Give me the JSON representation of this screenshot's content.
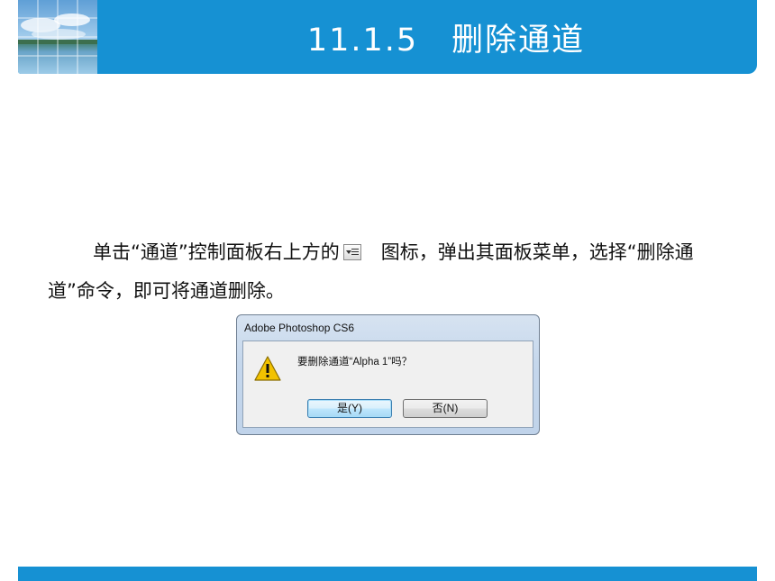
{
  "slide": {
    "title": "11.1.5　删除通道",
    "paragraph_before_icon": "单击“通道”控制面板右上方的",
    "paragraph_after_icon": "图标，弹出其面板菜单，选择“删除通道”命令，即可将通道删除。",
    "inline_icon": "panel-menu-icon"
  },
  "dialog": {
    "title": "Adobe Photoshop CS6",
    "message": "要删除通道“Alpha 1”吗？",
    "icon": "warning-icon",
    "yes_label": "是(Y)",
    "no_label": "否(N)"
  },
  "colors": {
    "accent": "#1691d3",
    "dialog_frame": "#c5d7ec",
    "warning": "#f2c200"
  }
}
